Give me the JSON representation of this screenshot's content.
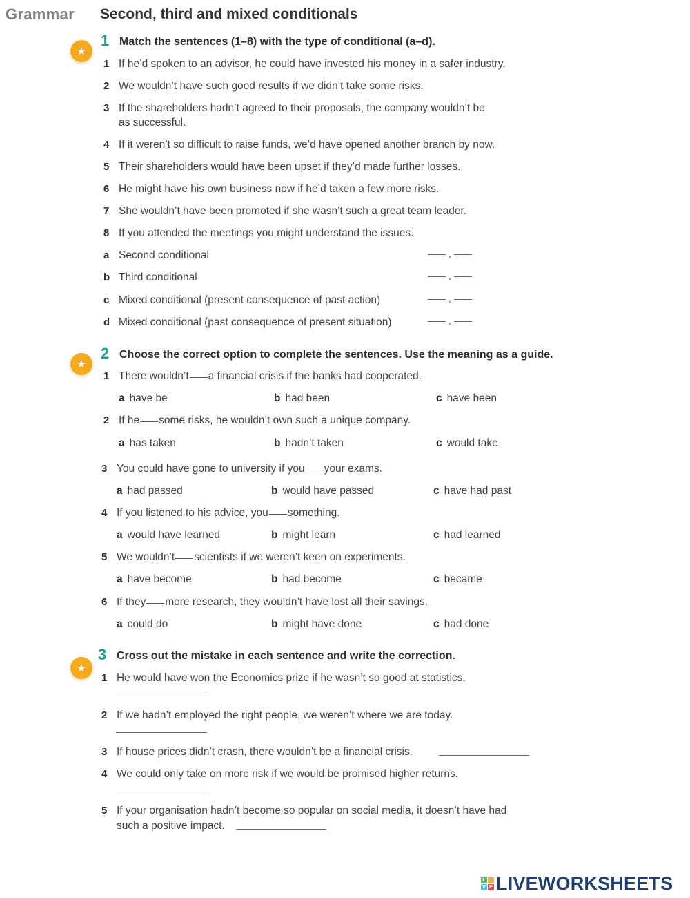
{
  "header": {
    "section_label": "Grammar",
    "title": "Second, third and mixed conditionals"
  },
  "colors": {
    "exercise_number": "#1aa38a",
    "star_badge": "#f5a91f",
    "logo_text": "#1d3f73"
  },
  "exercises": [
    {
      "number": "1",
      "badge_icon": "star-icon",
      "instruction": "Match the sentences (1–8) with the type of conditional (a–d).",
      "sentences": [
        {
          "num": "1",
          "text": "If he’d spoken to an advisor, he could have invested his money in a safer industry."
        },
        {
          "num": "2",
          "text": "We wouldn’t have such good results if we didn’t take some risks."
        },
        {
          "num": "3",
          "text": "If the shareholders hadn’t agreed to their proposals, the company wouldn’t be",
          "text2": "as successful."
        },
        {
          "num": "4",
          "text": "If it weren’t so difficult to raise funds, we’d have opened another branch by now."
        },
        {
          "num": "5",
          "text": "Their shareholders would have been upset if they’d made further losses."
        },
        {
          "num": "6",
          "text": "He might have his own business now if he’d taken a few more risks."
        },
        {
          "num": "7",
          "text": "She wouldn’t have been promoted if she wasn’t such a great team leader."
        },
        {
          "num": "8",
          "text": "If you attended the meetings you might understand the issues."
        }
      ],
      "types": [
        {
          "letter": "a",
          "text": "Second conditional",
          "answer1": "",
          "answer2": ""
        },
        {
          "letter": "b",
          "text": "Third conditional",
          "answer1": "",
          "answer2": ""
        },
        {
          "letter": "c",
          "text": "Mixed conditional (present consequence of past action)",
          "answer1": "",
          "answer2": ""
        },
        {
          "letter": "d",
          "text": "Mixed conditional (past consequence of present situation)",
          "answer1": "",
          "answer2": ""
        }
      ],
      "separator": ","
    },
    {
      "number": "2",
      "badge_icon": "star-icon",
      "instruction": "Choose the correct option to complete the sentences. Use the meaning as a guide.",
      "questions": [
        {
          "num": "1",
          "before": "There wouldn’t",
          "after": "a financial crisis if the banks had cooperated.",
          "options": [
            {
              "letter": "a",
              "text": "have be"
            },
            {
              "letter": "b",
              "text": "had been"
            },
            {
              "letter": "c",
              "text": "have been"
            }
          ]
        },
        {
          "num": "2",
          "before": "If he",
          "after": "some risks, he wouldn’t own such a unique company.",
          "options": [
            {
              "letter": "a",
              "text": "has taken"
            },
            {
              "letter": "b",
              "text": "hadn’t taken"
            },
            {
              "letter": "c",
              "text": "would take"
            }
          ]
        },
        {
          "num": "3",
          "before": "You could have gone to university if you",
          "after": "your exams.",
          "options": [
            {
              "letter": "a",
              "text": "had passed"
            },
            {
              "letter": "b",
              "text": "would have passed"
            },
            {
              "letter": "c",
              "text": "have had past"
            }
          ]
        },
        {
          "num": "4",
          "before": "If you listened to his advice, you",
          "after": "something.",
          "options": [
            {
              "letter": "a",
              "text": "would have learned"
            },
            {
              "letter": "b",
              "text": "might learn"
            },
            {
              "letter": "c",
              "text": "had learned"
            }
          ]
        },
        {
          "num": "5",
          "before": "We wouldn’t",
          "after": "scientists if we weren’t keen on experiments.",
          "options": [
            {
              "letter": "a",
              "text": "have become"
            },
            {
              "letter": "b",
              "text": "had become"
            },
            {
              "letter": "c",
              "text": "became"
            }
          ]
        },
        {
          "num": "6",
          "before": "If they",
          "after": "more research, they wouldn’t have lost all their savings.",
          "options": [
            {
              "letter": "a",
              "text": "could do"
            },
            {
              "letter": "b",
              "text": "might have done"
            },
            {
              "letter": "c",
              "text": "had done"
            }
          ]
        }
      ]
    },
    {
      "number": "3",
      "badge_icon": "star-icon",
      "instruction": "Cross out the mistake in each sentence and write the correction.",
      "sentences": [
        {
          "num": "1",
          "text": "He would have won the Economics prize if he wasn’t so good at statistics.",
          "answer": ""
        },
        {
          "num": "2",
          "text": "If we hadn’t employed the right people, we weren’t where we are today.",
          "answer": ""
        },
        {
          "num": "3",
          "text": "If house prices didn’t crash, there wouldn’t be a financial crisis.",
          "answer": ""
        },
        {
          "num": "4",
          "text": "We could only take on more risk if we would be promised higher returns.",
          "answer": ""
        },
        {
          "num": "5",
          "text": "If your organisation hadn’t become so popular on social media, it doesn’t have had",
          "text2": "such a positive impact.",
          "answer": ""
        }
      ]
    }
  ],
  "footer": {
    "logo_text": "LIVEWORKSHEETS",
    "logo_icon_letters": [
      "L",
      "I",
      "V",
      "E"
    ],
    "logo_icon_colors": [
      "#5cb85c",
      "#f0ad4e",
      "#5bc0de",
      "#d9534f"
    ]
  }
}
